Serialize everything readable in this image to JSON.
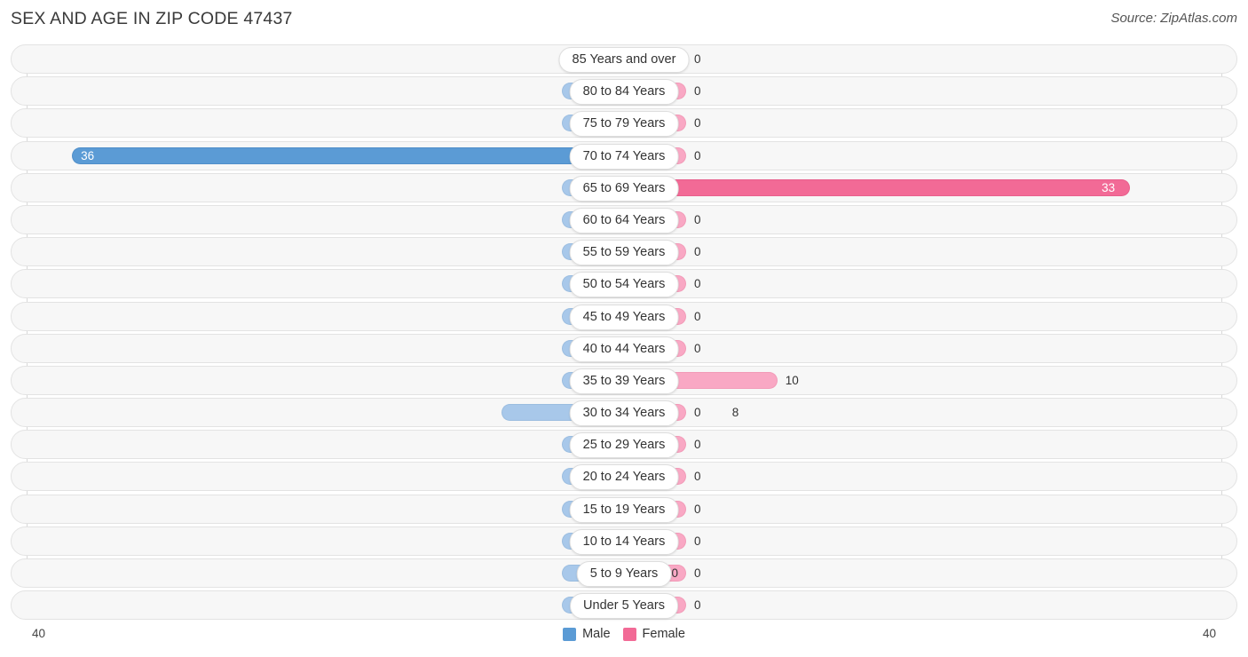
{
  "header": {
    "title": "SEX AND AGE IN ZIP CODE 47437",
    "source": "Source: ZipAtlas.com"
  },
  "axis": {
    "left_max": "40",
    "right_max": "40"
  },
  "legend": {
    "male_label": "Male",
    "female_label": "Female",
    "male_color": "#5b9bd5",
    "female_color": "#f26a96"
  },
  "colors": {
    "male_light": "#a8c8ea",
    "male_dark": "#5b9bd5",
    "female_light": "#f9a8c4",
    "female_dark": "#f26a96",
    "track": "#f7f7f7",
    "gridline": "#d8d8d8"
  },
  "chart_data": {
    "type": "bar",
    "title": "SEX AND AGE IN ZIP CODE 47437",
    "subtitle": "Source: ZipAtlas.com",
    "xlabel": "",
    "ylabel": "",
    "orientation": "horizontal",
    "layout": "population-pyramid",
    "grid": true,
    "legend_position": "bottom-center",
    "xlim": [
      40,
      40
    ],
    "axis_max_per_side": 40,
    "categories": [
      "85 Years and over",
      "80 to 84 Years",
      "75 to 79 Years",
      "70 to 74 Years",
      "65 to 69 Years",
      "60 to 64 Years",
      "55 to 59 Years",
      "50 to 54 Years",
      "45 to 49 Years",
      "40 to 44 Years",
      "35 to 39 Years",
      "30 to 34 Years",
      "25 to 29 Years",
      "20 to 24 Years",
      "15 to 19 Years",
      "10 to 14 Years",
      "5 to 9 Years",
      "Under 5 Years"
    ],
    "series": [
      {
        "name": "Male",
        "color": "#5b9bd5",
        "values": [
          0,
          0,
          0,
          36,
          0,
          0,
          0,
          0,
          0,
          0,
          0,
          8,
          0,
          0,
          0,
          0,
          0,
          0
        ]
      },
      {
        "name": "Female",
        "color": "#f26a96",
        "values": [
          0,
          0,
          0,
          0,
          33,
          0,
          0,
          0,
          0,
          0,
          10,
          0,
          0,
          0,
          0,
          0,
          0,
          0
        ]
      }
    ]
  },
  "rows": [
    {
      "label": "85 Years and over",
      "male": "0",
      "female": "0",
      "male_value": 0,
      "female_value": 0
    },
    {
      "label": "80 to 84 Years",
      "male": "0",
      "female": "0",
      "male_value": 0,
      "female_value": 0
    },
    {
      "label": "75 to 79 Years",
      "male": "0",
      "female": "0",
      "male_value": 0,
      "female_value": 0
    },
    {
      "label": "70 to 74 Years",
      "male": "36",
      "female": "0",
      "male_value": 36,
      "female_value": 0
    },
    {
      "label": "65 to 69 Years",
      "male": "0",
      "female": "33",
      "male_value": 0,
      "female_value": 33
    },
    {
      "label": "60 to 64 Years",
      "male": "0",
      "female": "0",
      "male_value": 0,
      "female_value": 0
    },
    {
      "label": "55 to 59 Years",
      "male": "0",
      "female": "0",
      "male_value": 0,
      "female_value": 0
    },
    {
      "label": "50 to 54 Years",
      "male": "0",
      "female": "0",
      "male_value": 0,
      "female_value": 0
    },
    {
      "label": "45 to 49 Years",
      "male": "0",
      "female": "0",
      "male_value": 0,
      "female_value": 0
    },
    {
      "label": "40 to 44 Years",
      "male": "0",
      "female": "0",
      "male_value": 0,
      "female_value": 0
    },
    {
      "label": "35 to 39 Years",
      "male": "0",
      "female": "10",
      "male_value": 0,
      "female_value": 10
    },
    {
      "label": "30 to 34 Years",
      "male": "8",
      "female": "0",
      "male_value": 8,
      "female_value": 0
    },
    {
      "label": "25 to 29 Years",
      "male": "0",
      "female": "0",
      "male_value": 0,
      "female_value": 0
    },
    {
      "label": "20 to 24 Years",
      "male": "0",
      "female": "0",
      "male_value": 0,
      "female_value": 0
    },
    {
      "label": "15 to 19 Years",
      "male": "0",
      "female": "0",
      "male_value": 0,
      "female_value": 0
    },
    {
      "label": "10 to 14 Years",
      "male": "0",
      "female": "0",
      "male_value": 0,
      "female_value": 0
    },
    {
      "label": "5 to 9 Years",
      "male": "0",
      "female": "0",
      "male_value": 0,
      "female_value": 0
    },
    {
      "label": "Under 5 Years",
      "male": "0",
      "female": "0",
      "male_value": 0,
      "female_value": 0
    }
  ]
}
